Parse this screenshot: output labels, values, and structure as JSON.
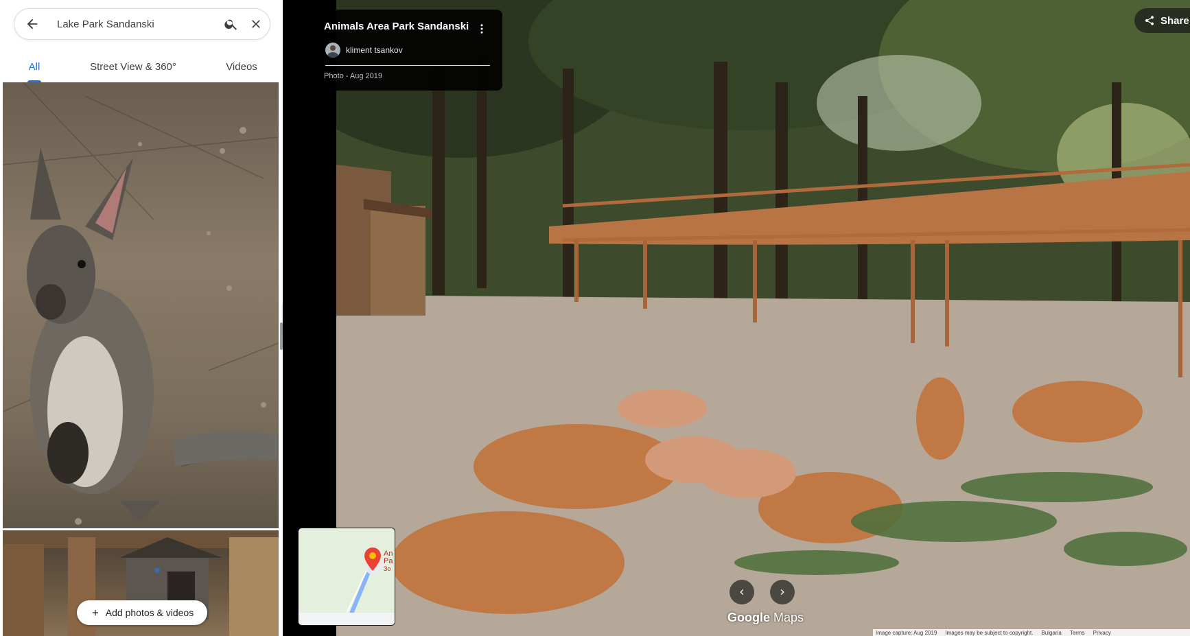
{
  "search": {
    "value": "Lake Park Sandanski",
    "back_icon": "arrow-left-icon",
    "search_icon": "search-icon",
    "clear_icon": "close-icon"
  },
  "tabs": [
    {
      "label": "All",
      "active": true
    },
    {
      "label": "Street View & 360°",
      "active": false
    },
    {
      "label": "Videos",
      "active": false
    }
  ],
  "photos": [
    {
      "subject": "wallaby"
    },
    {
      "subject": "wooden animal shelter"
    }
  ],
  "add_photos": {
    "label": "Add photos & videos",
    "icon": "plus-icon"
  },
  "info_card": {
    "title": "Animals Area Park Sandanski",
    "author": "kliment tsankov",
    "date": "Photo - Aug 2019",
    "more_icon": "more-vert-icon"
  },
  "share": {
    "label": "Share",
    "icon": "share-icon"
  },
  "minimap": {
    "label_lines": [
      "An",
      "Pa",
      "Зо"
    ]
  },
  "logo": {
    "part1": "Google",
    "part2": "Maps"
  },
  "footer": {
    "items": [
      "Image capture: Aug 2019",
      "Images may be subject to copyright.",
      "Bulgaria",
      "Terms",
      "Privacy"
    ]
  },
  "colors": {
    "accent": "#1a73e8",
    "pin": "#ea4335"
  }
}
